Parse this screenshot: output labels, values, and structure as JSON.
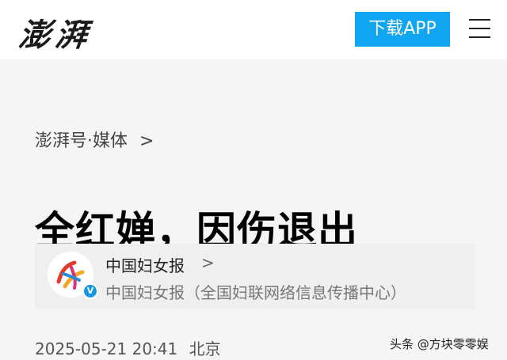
{
  "header": {
    "logo_text": "澎湃",
    "download_label": "下载APP",
    "menu_icon": "hamburger-menu-icon"
  },
  "breadcrumb": {
    "text": "澎湃号·媒体",
    "chevron": ">"
  },
  "article": {
    "title": "全红婵，因伤退出",
    "date": "2025-05-21 20:41",
    "location": "北京"
  },
  "author": {
    "name": "中国妇女报",
    "chevron": ">",
    "description": "中国妇女报（全国妇联网络信息传播中心）",
    "verified_mark": "V"
  },
  "watermark": {
    "text": "头条 @方块零零娱"
  },
  "colors": {
    "accent": "#10a5f0",
    "background": "#f5f5f5",
    "header_bg": "#ffffff",
    "verified": "#1296e6"
  }
}
